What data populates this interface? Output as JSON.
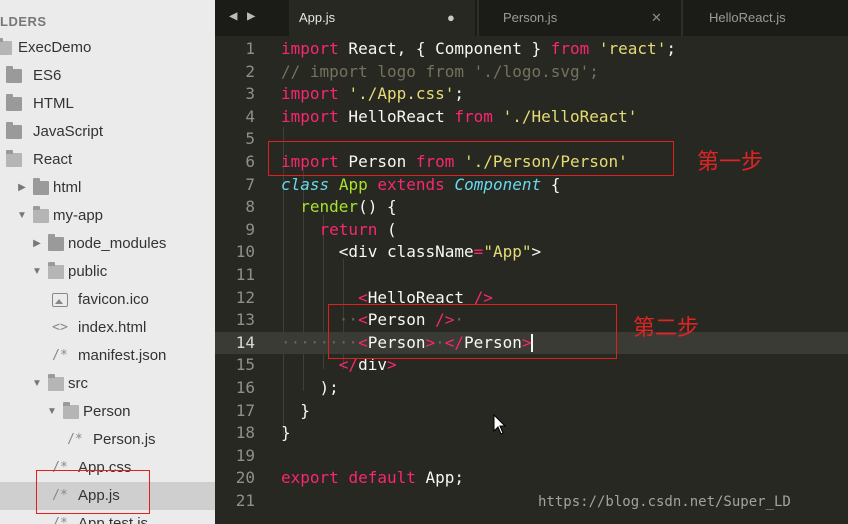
{
  "sidebar": {
    "header": "LDERS",
    "items": [
      {
        "label": "ExecDemo",
        "type": "folder-open",
        "depth": 0,
        "arrow": "▼"
      },
      {
        "label": "ES6",
        "type": "folder",
        "depth": 1,
        "arrow": ""
      },
      {
        "label": "HTML",
        "type": "folder",
        "depth": 1,
        "arrow": ""
      },
      {
        "label": "JavaScript",
        "type": "folder",
        "depth": 1,
        "arrow": ""
      },
      {
        "label": "React",
        "type": "folder-open",
        "depth": 1,
        "arrow": ""
      },
      {
        "label": "html",
        "type": "folder",
        "depth": 2,
        "arrow": "▶"
      },
      {
        "label": "my-app",
        "type": "folder-open",
        "depth": 2,
        "arrow": "▼"
      },
      {
        "label": "node_modules",
        "type": "folder",
        "depth": 3,
        "arrow": "▶"
      },
      {
        "label": "public",
        "type": "folder-open",
        "depth": 3,
        "arrow": "▼"
      },
      {
        "label": "favicon.ico",
        "type": "image",
        "depth": 4,
        "arrow": ""
      },
      {
        "label": "index.html",
        "type": "code",
        "depth": 4,
        "arrow": ""
      },
      {
        "label": "manifest.json",
        "type": "comment",
        "depth": 4,
        "arrow": ""
      },
      {
        "label": "src",
        "type": "folder-open",
        "depth": 3,
        "arrow": "▼"
      },
      {
        "label": "Person",
        "type": "folder-open",
        "depth": 4,
        "arrow": "▼"
      },
      {
        "label": "Person.js",
        "type": "comment",
        "depth": 5,
        "arrow": ""
      },
      {
        "label": "App.css",
        "type": "comment",
        "depth": 4,
        "arrow": ""
      },
      {
        "label": "App.js",
        "type": "comment",
        "depth": 4,
        "arrow": "",
        "selected": true
      },
      {
        "label": "App.test.js",
        "type": "comment",
        "depth": 4,
        "arrow": ""
      }
    ]
  },
  "tabs": [
    {
      "name": "App.js",
      "active": true,
      "close": "●"
    },
    {
      "name": "Person.js",
      "active": false,
      "close": "✕"
    },
    {
      "name": "HelloReact.js",
      "active": false,
      "close": ""
    }
  ],
  "nav": {
    "back": "◀",
    "forward": "▶"
  },
  "editor": {
    "current_line": 14,
    "lines": [
      [
        [
          "kw",
          "import"
        ],
        [
          "p",
          " React, { Component } "
        ],
        [
          "kw",
          "from"
        ],
        [
          "p",
          " "
        ],
        [
          "str",
          "'react'"
        ],
        [
          "p",
          ";"
        ]
      ],
      [
        [
          "cmt",
          "// import logo from './logo.svg';"
        ]
      ],
      [
        [
          "kw",
          "import"
        ],
        [
          "p",
          " "
        ],
        [
          "str",
          "'./App.css'"
        ],
        [
          "p",
          ";"
        ]
      ],
      [
        [
          "kw",
          "import"
        ],
        [
          "p",
          " HelloReact "
        ],
        [
          "kw",
          "from"
        ],
        [
          "p",
          " "
        ],
        [
          "str",
          "'./HelloReact'"
        ]
      ],
      [],
      [
        [
          "kw",
          "import"
        ],
        [
          "p",
          " Person "
        ],
        [
          "kw",
          "from"
        ],
        [
          "p",
          " "
        ],
        [
          "str",
          "'./Person/Person'"
        ]
      ],
      [
        [
          "cls",
          "class"
        ],
        [
          "p",
          " "
        ],
        [
          "ttl",
          "App"
        ],
        [
          "p",
          " "
        ],
        [
          "kw",
          "extends"
        ],
        [
          "p",
          " "
        ],
        [
          "cls",
          "Component"
        ],
        [
          "p",
          " {"
        ]
      ],
      [
        [
          "p",
          "  "
        ],
        [
          "fn",
          "render"
        ],
        [
          "p",
          "() {"
        ]
      ],
      [
        [
          "p",
          "    "
        ],
        [
          "kw",
          "return"
        ],
        [
          "p",
          " ("
        ]
      ],
      [
        [
          "p",
          "      <div "
        ],
        [
          "p",
          "className"
        ],
        [
          "kw",
          "="
        ],
        [
          "str",
          "\"App\""
        ],
        [
          "p",
          ">"
        ]
      ],
      [],
      [
        [
          "p",
          "        "
        ],
        [
          "tag",
          "<"
        ],
        [
          "p",
          "HelloReact "
        ],
        [
          "tag",
          "/>"
        ]
      ],
      [
        [
          "ws",
          "      ··"
        ],
        [
          "tag",
          "<"
        ],
        [
          "p",
          "Person "
        ],
        [
          "tag",
          "/>"
        ],
        [
          "ws",
          "·"
        ]
      ],
      [
        [
          "ws",
          "········"
        ],
        [
          "tag",
          "<"
        ],
        [
          "p",
          "Person"
        ],
        [
          "tag",
          ">"
        ],
        [
          "ws",
          "·"
        ],
        [
          "tag",
          "</"
        ],
        [
          "p",
          "Person"
        ],
        [
          "tag",
          ">"
        ],
        [
          "cursor",
          ""
        ]
      ],
      [
        [
          "p",
          "      "
        ],
        [
          "tag",
          "</"
        ],
        [
          "p",
          "div"
        ],
        [
          "tag",
          ">"
        ]
      ],
      [
        [
          "p",
          "    );"
        ]
      ],
      [
        [
          "p",
          "  }"
        ]
      ],
      [
        [
          "p",
          "}"
        ]
      ],
      [],
      [
        [
          "kw",
          "export"
        ],
        [
          "p",
          " "
        ],
        [
          "kw",
          "default"
        ],
        [
          "p",
          " App;"
        ]
      ],
      []
    ]
  },
  "annotations": {
    "step1": "第一步",
    "step2": "第二步"
  },
  "watermark": "https://blog.csdn.net/Super_LD",
  "colors": {
    "sidebar_bg": "#ebebeb",
    "editor_bg": "#272822",
    "tabbar_bg": "#1b1c18",
    "keyword": "#f92672",
    "string": "#e6db74",
    "comment": "#75715e",
    "class": "#66d9ef",
    "function": "#a6e22e",
    "annotation_red": "#e02020"
  }
}
